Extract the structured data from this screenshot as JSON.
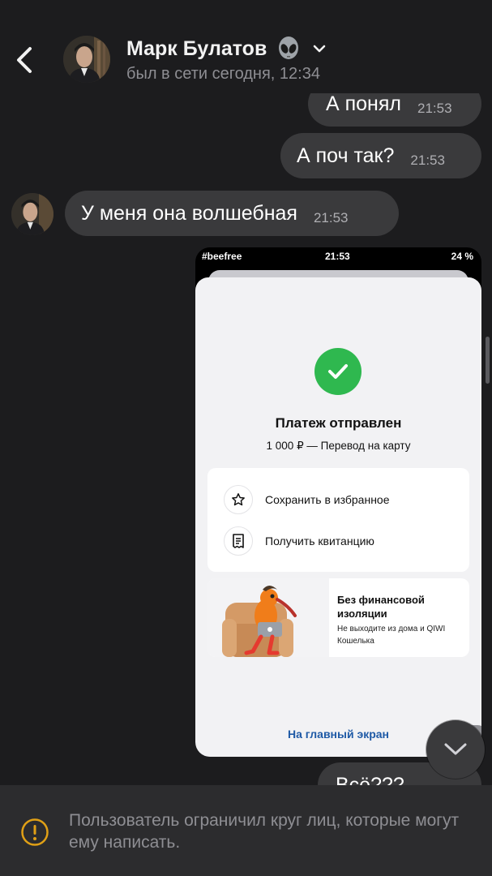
{
  "header": {
    "name": "Марк Булатов",
    "status": "был в сети сегодня, 12:34"
  },
  "messages": [
    {
      "text": "А понял",
      "time": "21:53",
      "outgoing": true
    },
    {
      "text": "А поч так?",
      "time": "21:53",
      "outgoing": true
    },
    {
      "text": "У меня она волшебная",
      "time": "21:53",
      "outgoing": false
    }
  ],
  "screenshot": {
    "carrier": "#beefree",
    "clock": "21:53",
    "battery": "24 %",
    "title": "Платеж отправлен",
    "subtitle": "1 000 ₽ — Перевод на карту",
    "actions": [
      "Сохранить в избранное",
      "Получить квитанцию"
    ],
    "promo_title": "Без финансовой изоляции",
    "promo_sub": "Не выходите из дома и QIWI Кошелька",
    "home_link": "На главный экран",
    "accent": "#2fb84f",
    "link_color": "#1f5aa6"
  },
  "partial_message": "Всё???",
  "restriction": {
    "text": "Пользователь ограничил круг лиц, которые могут ему написать.",
    "icon_color": "#e0a016"
  }
}
